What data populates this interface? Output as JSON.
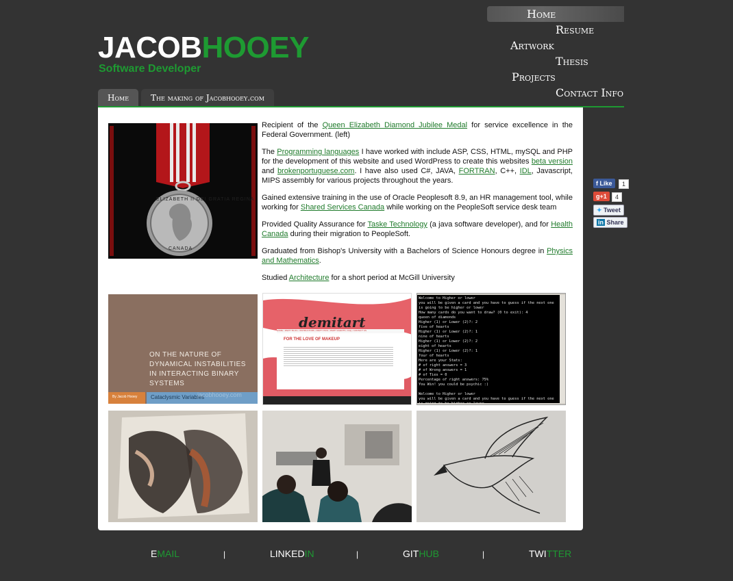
{
  "header": {
    "logo_first": "JACOB",
    "logo_last": "HOOEY",
    "tagline": "Software Developer"
  },
  "nav": {
    "home": "Home",
    "resume": "Resume",
    "artwork": "Artwork",
    "thesis": "Thesis",
    "projects": "Projects",
    "contact": "Contact Info"
  },
  "tabs": [
    {
      "label": "Home",
      "active": true
    },
    {
      "label": "The making of Jacobhooey.com",
      "active": false
    }
  ],
  "content": {
    "p1": {
      "pre": "Recipient of the ",
      "link": "Queen Elizabeth Diamond Jubilee Medal",
      "post": " for service excellence in the Federal Government. (left)"
    },
    "p2": {
      "t1": "The ",
      "l1": "Programming languages",
      "t2": " I have worked with include ASP, CSS, HTML, mySQL and PHP for the development of this website and used WordPress to create this websites ",
      "l2": "beta version",
      "t3": " and ",
      "l3": "brokenportuguese.com",
      "t4": ". I have also used C#, JAVA, ",
      "l4": "FORTRAN",
      "t5": ", C++, ",
      "l5": "IDL",
      "t6": ", Javascript, MIPS assembly for various projects throughout the years."
    },
    "p3": {
      "pre": "Gained extensive training in the use of Oracle Peoplesoft 8.9, an HR management tool, while working for ",
      "link": "Shared Services Canada",
      "post": " while working on the PeopleSoft service desk team"
    },
    "p4": {
      "t1": "Provided Quality Assurance for ",
      "l1": "Taske Technology",
      "t2": " (a java software developer), and for ",
      "l2": "Health Canada",
      "t3": " during their migration to PeopleSoft."
    },
    "p5": {
      "pre": "Graduated from Bishop's University with a Bachelors of Science Honours degree in ",
      "link": "Physics and Mathematics",
      "post": "."
    },
    "p6": {
      "pre": "Studied ",
      "link": "Architecture",
      "post": " for a short period at McGill University"
    }
  },
  "medal": {
    "inscription": "ELIZABETH II DEI GRATIA REGINA",
    "country": "CANADA"
  },
  "thumbs": {
    "thesis": {
      "title": "ON THE NATURE OF DYNAMICAL INSTABILITIES IN INTERACTING BINARY SYSTEMS",
      "author": "By Jacob Hooey",
      "subtitle": "Cataclysmic Variables",
      "watermark": "jacobhooey.com"
    },
    "demitart": {
      "logo": "demitart",
      "heading": "FOR THE LOVE OF MAKEUP",
      "menu": "HOME • PARTY BLOG • INSTRUCTORS • PARTY PICS • PARTY EVENTS • FAQ • CONTACT US"
    },
    "console": {
      "lines": [
        "Welcome to Higher or lower",
        "you will be given a card and you have to guess if the next one is going to be higher or lower",
        "How many cards do you want to draw? (0 to exit): 4",
        "queen of diamonds",
        "Higher (1) or Lower (2)?: 2",
        "five of hearts",
        "Higher (1) or Lower (2)?: 1",
        "nine of hearts",
        "Higher (1) or Lower (2)?: 2",
        "eight of hearts",
        "Higher (1) or Lower (2)?: 1",
        "four of hearts",
        "Here are your Stats:",
        "# of right answers = 3",
        "# of Wrong answers = 1",
        "# of Ties = 0",
        "Percentage of right answers: 75%",
        "You Win! you could be psychic :)",
        "",
        "Welcome to Higher or lower",
        "you will be given a card and you have to guess if the next one is going to be higher or lower",
        "How many cards do you want to draw? (0 to exit):"
      ]
    }
  },
  "social": {
    "like": "Like",
    "like_count": "1",
    "gplus": "+1",
    "gplus_count": "4",
    "tweet": "Tweet",
    "share": "Share"
  },
  "footer": {
    "email_a": "E",
    "email_b": "MAIL",
    "linkedin_a": "LINKED",
    "linkedin_b": "IN",
    "github_a": "GIT",
    "github_b": "HUB",
    "twitter_a": "TWI",
    "twitter_b": "TTER",
    "sep": "|"
  },
  "colors": {
    "brand_green": "#1e9a32",
    "background": "#333333",
    "link": "#1e7a2a"
  }
}
